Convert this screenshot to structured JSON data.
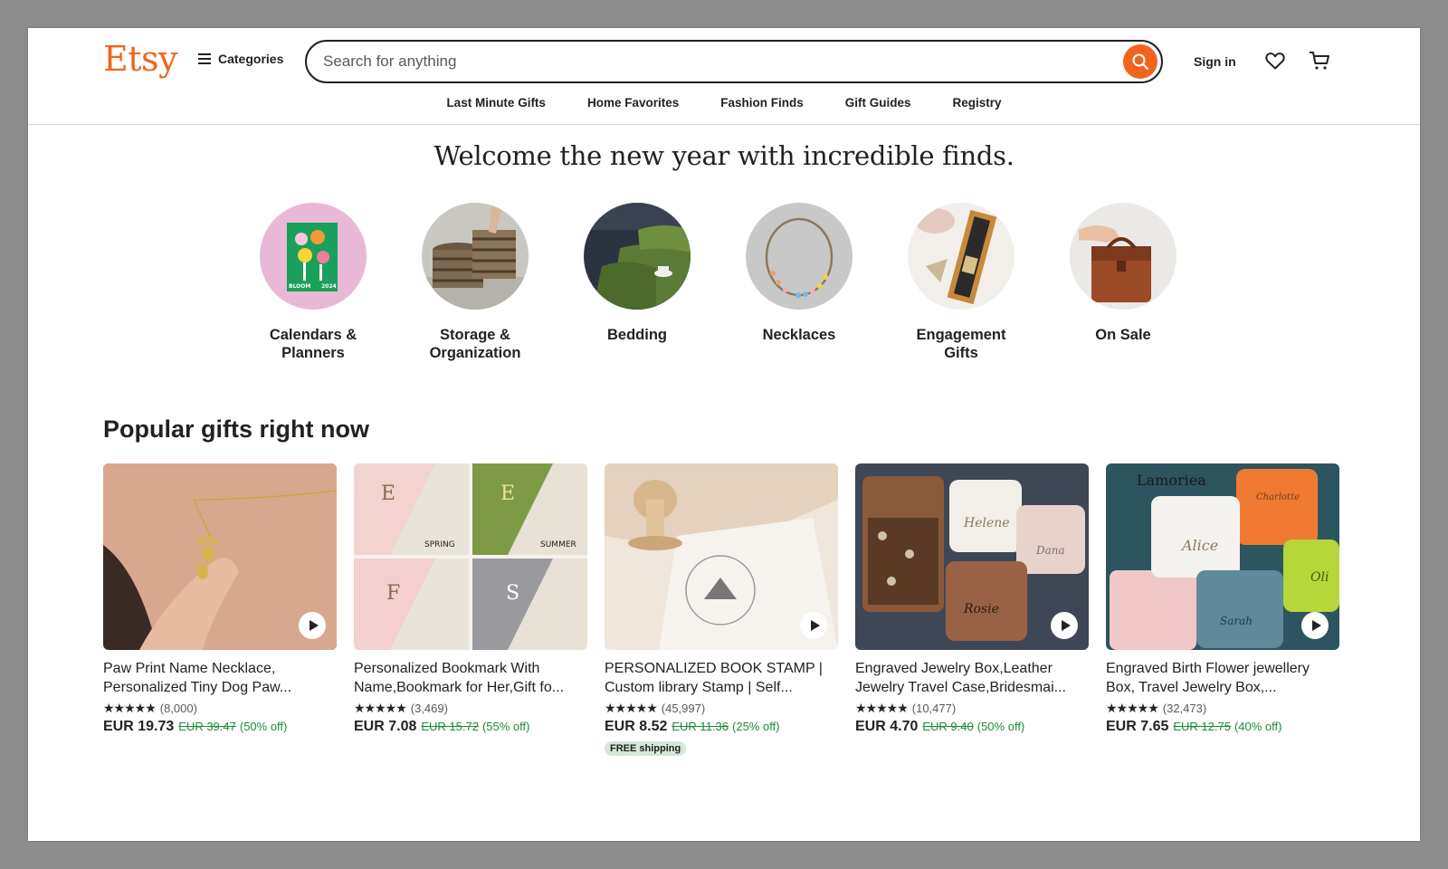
{
  "header": {
    "logo": "Etsy",
    "categories_label": "Categories",
    "search_placeholder": "Search for anything",
    "signin_label": "Sign in"
  },
  "nav": [
    "Last Minute Gifts",
    "Home Favorites",
    "Fashion Finds",
    "Gift Guides",
    "Registry"
  ],
  "welcome": "Welcome the new year with incredible finds.",
  "categories": [
    {
      "line1": "Calendars &",
      "line2": "Planners"
    },
    {
      "line1": "Storage &",
      "line2": "Organization"
    },
    {
      "line1": "Bedding",
      "line2": ""
    },
    {
      "line1": "Necklaces",
      "line2": ""
    },
    {
      "line1": "Engagement",
      "line2": "Gifts"
    },
    {
      "line1": "On Sale",
      "line2": ""
    }
  ],
  "calendar_text": {
    "word": "BLOOM",
    "year": "2024"
  },
  "bookmark_labels": {
    "spring": "SPRING",
    "summer": "SUMMER"
  },
  "popular_title": "Popular gifts right now",
  "products": [
    {
      "title1": "Paw Print Name Necklace,",
      "title2": "Personalized Tiny Dog Paw...",
      "stars": "★★★★★",
      "reviews": "(8,000)",
      "price": "EUR 19.73",
      "was": "EUR 39.47",
      "off": "(50% off)",
      "shipping": ""
    },
    {
      "title1": "Personalized Bookmark With",
      "title2": "Name,Bookmark for Her,Gift fo...",
      "stars": "★★★★★",
      "reviews": "(3,469)",
      "price": "EUR 7.08",
      "was": "EUR 15.72",
      "off": "(55% off)",
      "shipping": ""
    },
    {
      "title1": "PERSONALIZED BOOK STAMP |",
      "title2": "Custom library Stamp | Self...",
      "stars": "★★★★★",
      "reviews": "(45,997)",
      "price": "EUR 8.52",
      "was": "EUR 11.36",
      "off": "(25% off)",
      "shipping": "FREE shipping"
    },
    {
      "title1": "Engraved Jewelry Box,Leather",
      "title2": "Jewelry Travel Case,Bridesmai...",
      "stars": "★★★★★",
      "reviews": "(10,477)",
      "price": "EUR 4.70",
      "was": "EUR 9.40",
      "off": "(50% off)",
      "shipping": ""
    },
    {
      "title1": "Engraved Birth Flower jewellery",
      "title2": "Box, Travel Jewelry Box,...",
      "stars": "★★★★★",
      "reviews": "(32,473)",
      "price": "EUR 7.65",
      "was": "EUR 12.75",
      "off": "(40% off)",
      "shipping": ""
    }
  ],
  "engraved_names": {
    "p4_a": "Helene",
    "p4_b": "Dana",
    "p4_c": "Rosie",
    "p5_brand": "Lamoriea",
    "p5_a": "Charlotte",
    "p5_b": "Alice",
    "p5_c": "Sarah",
    "p5_d": "Oli"
  },
  "colors": {
    "brand": "#f1641e",
    "sale_green": "#1e8a3b",
    "free_ship_bg": "#d4e9d7"
  }
}
